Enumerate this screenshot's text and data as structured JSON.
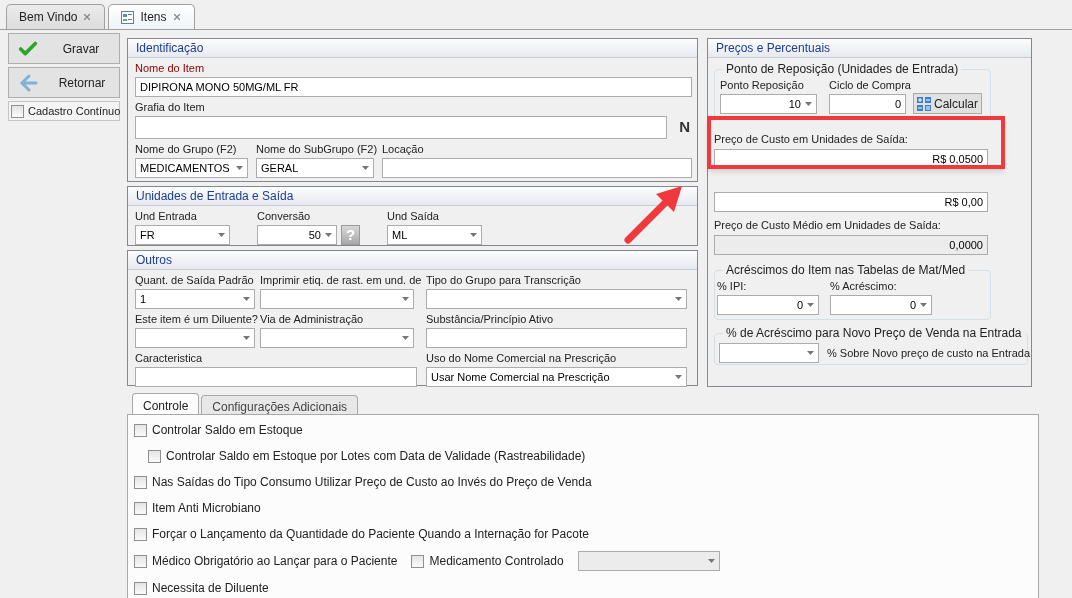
{
  "doc_tabs": [
    {
      "label": "Bem Vindo",
      "selected": false
    },
    {
      "label": "Itens",
      "selected": true
    }
  ],
  "actions": [
    {
      "label": "Gravar",
      "kind": "save"
    },
    {
      "label": "Retornar",
      "kind": "back"
    }
  ],
  "continuous": {
    "label": "Cadastro Contínuo",
    "checked": false
  },
  "identificacao": {
    "title": "Identificação",
    "name": {
      "label": "Nome do Item",
      "required": true,
      "value": "DIPIRONA MONO 50MG/ML FR"
    },
    "grafia": {
      "label": "Grafia do Item",
      "required": false,
      "suffix": "N"
    },
    "row": [
      {
        "label": "Nome do Grupo (F2)",
        "kind": "combo",
        "value": "MEDICAMENTOS"
      },
      {
        "label": "Nome do SubGrupo (F2)",
        "kind": "combo",
        "value": "GERAL"
      },
      {
        "label": "Locação",
        "kind": "text"
      }
    ]
  },
  "unidades": {
    "title": "Unidades de Entrada e Saída",
    "fields": [
      {
        "label": "Und Entrada",
        "kind": "combo",
        "value": "FR"
      },
      {
        "label": "Conversão",
        "kind": "number-combo",
        "value": "50",
        "help": "?"
      },
      {
        "label": "Und Saída",
        "kind": "combo",
        "value": "ML"
      }
    ]
  },
  "outros": {
    "title": "Outros",
    "fields": [
      {
        "label": "Quant. de Saída Padrão",
        "kind": "combo",
        "value": "1"
      },
      {
        "label": "Imprimir etiq. de rast. em und. de",
        "kind": "combo"
      },
      {
        "label": "Tipo do Grupo para Transcrição",
        "kind": "combo"
      },
      {
        "label": "Este item é um Diluente?",
        "kind": "combo"
      },
      {
        "label": "Via de Administração",
        "kind": "combo"
      },
      {
        "label": "Substância/Princípio Ativo",
        "kind": "text"
      },
      {
        "label": "Caracteristica",
        "kind": "text"
      },
      {
        "label": "Uso do Nome Comercial na Prescrição",
        "kind": "combo",
        "value": "Usar Nome Comercial na Prescrição"
      }
    ]
  },
  "precos": {
    "title": "Preços e Percentuais",
    "reposicao": {
      "title": "Ponto de Reposição (Unidades de Entrada)",
      "fields": [
        {
          "label": "Ponto Reposição",
          "kind": "number-combo",
          "value": "10"
        },
        {
          "label": "Ciclo de Compra",
          "kind": "number",
          "value": "0"
        }
      ],
      "button": "Calcular"
    },
    "prices": [
      {
        "label": "Preço de Custo em Unidades de Saída:",
        "value": "R$ 0,0500",
        "disabled": false
      },
      {
        "value": "R$ 0,00",
        "disabled": false
      },
      {
        "label": "Preço de Custo Médio em Unidades de Saída:",
        "value": "0,0000",
        "disabled": true
      }
    ],
    "acrescimos": {
      "title": "Acréscimos do Item nas Tabelas de Mat/Med",
      "fields": [
        {
          "label": "% IPI:",
          "kind": "number-combo",
          "value": "0"
        },
        {
          "label": "% Acréscimo:",
          "kind": "number-combo",
          "value": "0"
        }
      ]
    },
    "novo": {
      "title": "% de Acréscimo para Novo Preço de Venda na Entrada",
      "field": {
        "kind": "combo"
      },
      "note": "% Sobre Novo preço de custo na Entrada"
    }
  },
  "sub_tabs": [
    {
      "label": "Controle",
      "selected": true
    },
    {
      "label": "Configurações Adicionais",
      "selected": false
    }
  ],
  "options": [
    {
      "label": "Controlar Saldo em Estoque",
      "checked": false,
      "children": [
        {
          "label": "Controlar Saldo em Estoque por Lotes com Data de Validade (Rastreabilidade)",
          "checked": false
        }
      ]
    },
    {
      "label": "Nas Saídas do Tipo Consumo Utilizar Preço de Custo ao Invés do Preço de Venda",
      "checked": false
    },
    {
      "label": "Item Anti Microbiano",
      "checked": false
    },
    {
      "label": "Forçar o Lançamento da Quantidade do Paciente Quando a Internação for Pacote",
      "checked": false
    },
    {
      "label": "Médico Obrigatório ao Lançar para o Paciente",
      "checked": false,
      "extra": {
        "label": "Medicamento Controlado",
        "checked": false,
        "combo": {
          "disabled": true
        }
      }
    },
    {
      "label": "Necessita de Diluente",
      "checked": false
    }
  ]
}
